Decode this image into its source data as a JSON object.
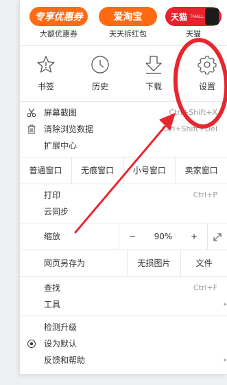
{
  "promos": [
    {
      "pill": "专享优惠券",
      "label": "大额优惠券",
      "color": "#ff6a13"
    },
    {
      "pill": "爱淘宝",
      "label": "天天拆红包",
      "color": "#ff6a13"
    },
    {
      "pill": "天猫",
      "sub": "TMALL.COM",
      "label": "天猫",
      "color": "#e8212f"
    }
  ],
  "toolbar": [
    {
      "label": "书签",
      "icon": "star-icon"
    },
    {
      "label": "历史",
      "icon": "clock-icon"
    },
    {
      "label": "下载",
      "icon": "download-icon"
    },
    {
      "label": "设置",
      "icon": "gear-icon"
    }
  ],
  "section1": [
    {
      "label": "屏幕截图",
      "shortcut": "Ctrl+Shift+X",
      "icon": "scissors-icon"
    },
    {
      "label": "清除浏览数据",
      "shortcut": "Ctrl+Shift+Del",
      "icon": "trash-icon"
    },
    {
      "label": "扩展中心",
      "shortcut": ""
    }
  ],
  "windows": [
    "普通窗口",
    "无痕窗口",
    "小号窗口",
    "卖家窗口"
  ],
  "section2": [
    {
      "label": "打印",
      "shortcut": "Ctrl+P"
    },
    {
      "label": "云同步",
      "shortcut": ""
    }
  ],
  "zoom": {
    "label": "缩放",
    "minus": "−",
    "value": "90%",
    "plus": "+"
  },
  "save": {
    "label": "网页另存为",
    "no_image": "无损图片",
    "file": "文件"
  },
  "section3": [
    {
      "label": "查找",
      "shortcut": "Ctrl+F"
    },
    {
      "label": "工具",
      "shortcut": "",
      "submenu": "▸"
    }
  ],
  "section4": [
    {
      "label": "检测升级"
    },
    {
      "label": "设为默认",
      "icon": "radio-icon"
    },
    {
      "label": "反馈和帮助",
      "submenu": "▸"
    }
  ],
  "annotation_color": "#e8262f"
}
